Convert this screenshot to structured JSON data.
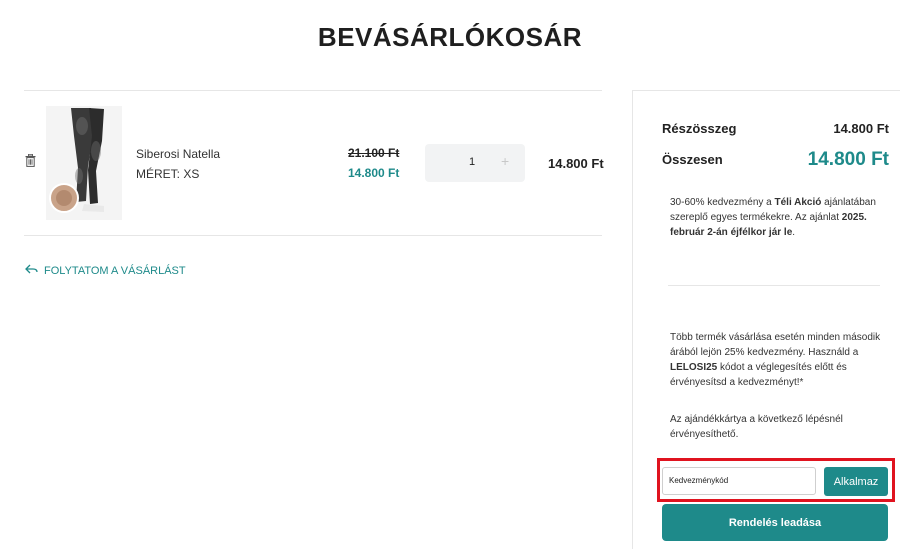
{
  "page": {
    "title": "BEVÁSÁRLÓKOSÁR"
  },
  "cart": {
    "items": [
      {
        "name": "Siberosi Natella",
        "size": "MÉRET: XS",
        "old_price": "21.100 Ft",
        "price": "14.800 Ft",
        "quantity": "1",
        "total": "14.800 Ft"
      }
    ],
    "continue_label": "FOLYTATOM A VÁSÁRLÁST"
  },
  "summary": {
    "subtotal_label": "Részösszeg",
    "subtotal_value": "14.800 Ft",
    "total_label": "Összesen",
    "total_value": "14.800 Ft",
    "promo1": {
      "part1": "30-60% kedvezmény a ",
      "bold1": "Téli Akció",
      "part2": " ajánlatában szereplő egyes termékekre. Az ajánlat ",
      "bold2": "2025. február 2-án éjfélkor jár le",
      "part3": "."
    },
    "promo2": {
      "part1": "Több termék vásárlása esetén minden második árából lejön 25% kedvezmény. Használd a ",
      "bold1": "LELOSI25",
      "part2": " kódot a véglegesítés előtt és érvényesítsd a kedvezményt!*"
    },
    "gift_text": "Az ajándékkártya a következő lépésnél érvényesíthető.",
    "coupon_value": "Kedvezménykód",
    "apply_label": "Alkalmaz",
    "order_label": "Rendelés leadása"
  },
  "colors": {
    "accent": "#1e8a8a",
    "highlight": "#e0131f"
  },
  "icons": {
    "remove": "trash-icon",
    "back": "back-arrow-icon",
    "plus": "plus-icon"
  }
}
